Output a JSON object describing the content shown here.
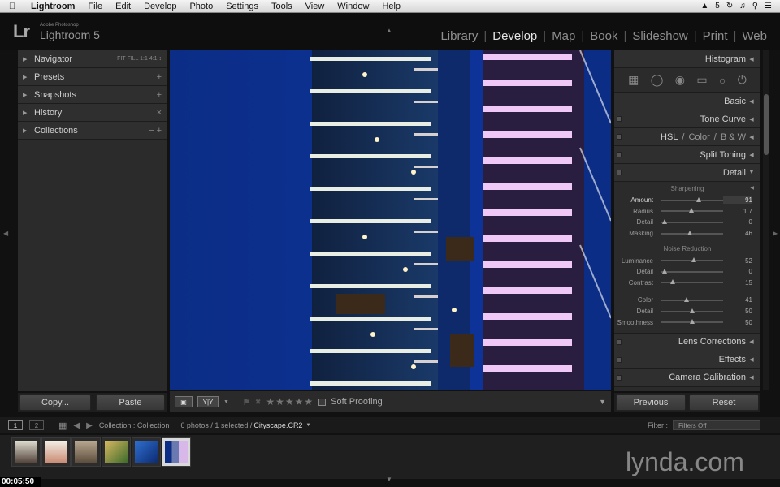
{
  "menubar": {
    "app": "Lightroom",
    "items": [
      "File",
      "Edit",
      "Develop",
      "Photo",
      "Settings",
      "Tools",
      "View",
      "Window",
      "Help"
    ],
    "status_text": "5"
  },
  "identity": {
    "logo": "Lr",
    "brand_small": "Adobe Photoshop",
    "brand": "Lightroom 5"
  },
  "modules": [
    {
      "label": "Library",
      "active": false
    },
    {
      "label": "Develop",
      "active": true
    },
    {
      "label": "Map",
      "active": false
    },
    {
      "label": "Book",
      "active": false
    },
    {
      "label": "Slideshow",
      "active": false
    },
    {
      "label": "Print",
      "active": false
    },
    {
      "label": "Web",
      "active": false
    }
  ],
  "left_panel": {
    "navigator": {
      "label": "Navigator",
      "controls": "FIT  FILL  1:1  4:1 ↕"
    },
    "presets": {
      "label": "Presets",
      "action": "+"
    },
    "snapshots": {
      "label": "Snapshots",
      "action": "+"
    },
    "history": {
      "label": "History",
      "action": "×"
    },
    "collections": {
      "label": "Collections",
      "action": "−  +"
    }
  },
  "left_buttons": {
    "copy": "Copy...",
    "paste": "Paste"
  },
  "right_panel": {
    "histogram": "Histogram",
    "basic": "Basic",
    "tone_curve": "Tone Curve",
    "hsl": {
      "hsl": "HSL",
      "color": "Color",
      "bw": "B & W",
      "sep": "/"
    },
    "split_toning": "Split Toning",
    "detail": "Detail",
    "sharpening": {
      "title": "Sharpening",
      "sliders": [
        {
          "label": "Amount",
          "value": "91",
          "fraction": 0.61,
          "active": true
        },
        {
          "label": "Radius",
          "value": "1.7",
          "fraction": 0.49,
          "active": false
        },
        {
          "label": "Detail",
          "value": "0",
          "fraction": 0.05,
          "active": false
        },
        {
          "label": "Masking",
          "value": "46",
          "fraction": 0.46,
          "active": false
        }
      ]
    },
    "noise_reduction": {
      "title": "Noise Reduction",
      "sliders": [
        {
          "label": "Luminance",
          "value": "52",
          "fraction": 0.52,
          "active": false
        },
        {
          "label": "Detail",
          "value": "0",
          "fraction": 0.05,
          "active": false
        },
        {
          "label": "Contrast",
          "value": "15",
          "fraction": 0.18,
          "active": false
        }
      ],
      "color_sliders": [
        {
          "label": "Color",
          "value": "41",
          "fraction": 0.41,
          "active": false
        },
        {
          "label": "Detail",
          "value": "50",
          "fraction": 0.5,
          "active": false
        },
        {
          "label": "Smoothness",
          "value": "50",
          "fraction": 0.5,
          "active": false
        }
      ]
    },
    "lens_corrections": "Lens Corrections",
    "effects": "Effects",
    "camera_calibration": "Camera Calibration"
  },
  "right_buttons": {
    "previous": "Previous",
    "reset": "Reset"
  },
  "toolbar": {
    "stars": "★★★★★",
    "soft_proofing": "Soft Proofing",
    "yy": "Y|Y"
  },
  "filmbar": {
    "screen1": "1",
    "screen2": "2",
    "source": "Collection : Collection",
    "count": "6 photos / 1 selected /",
    "filename": "Cityscape.CR2",
    "filter_label": "Filter :",
    "filter_value": "Filters Off"
  },
  "watermark": "lynda.com",
  "timecode": "00:05:50",
  "colors": {
    "accent": "#e6e6e6",
    "panel": "#2b2b2b",
    "sky": "#0d2f8a"
  }
}
